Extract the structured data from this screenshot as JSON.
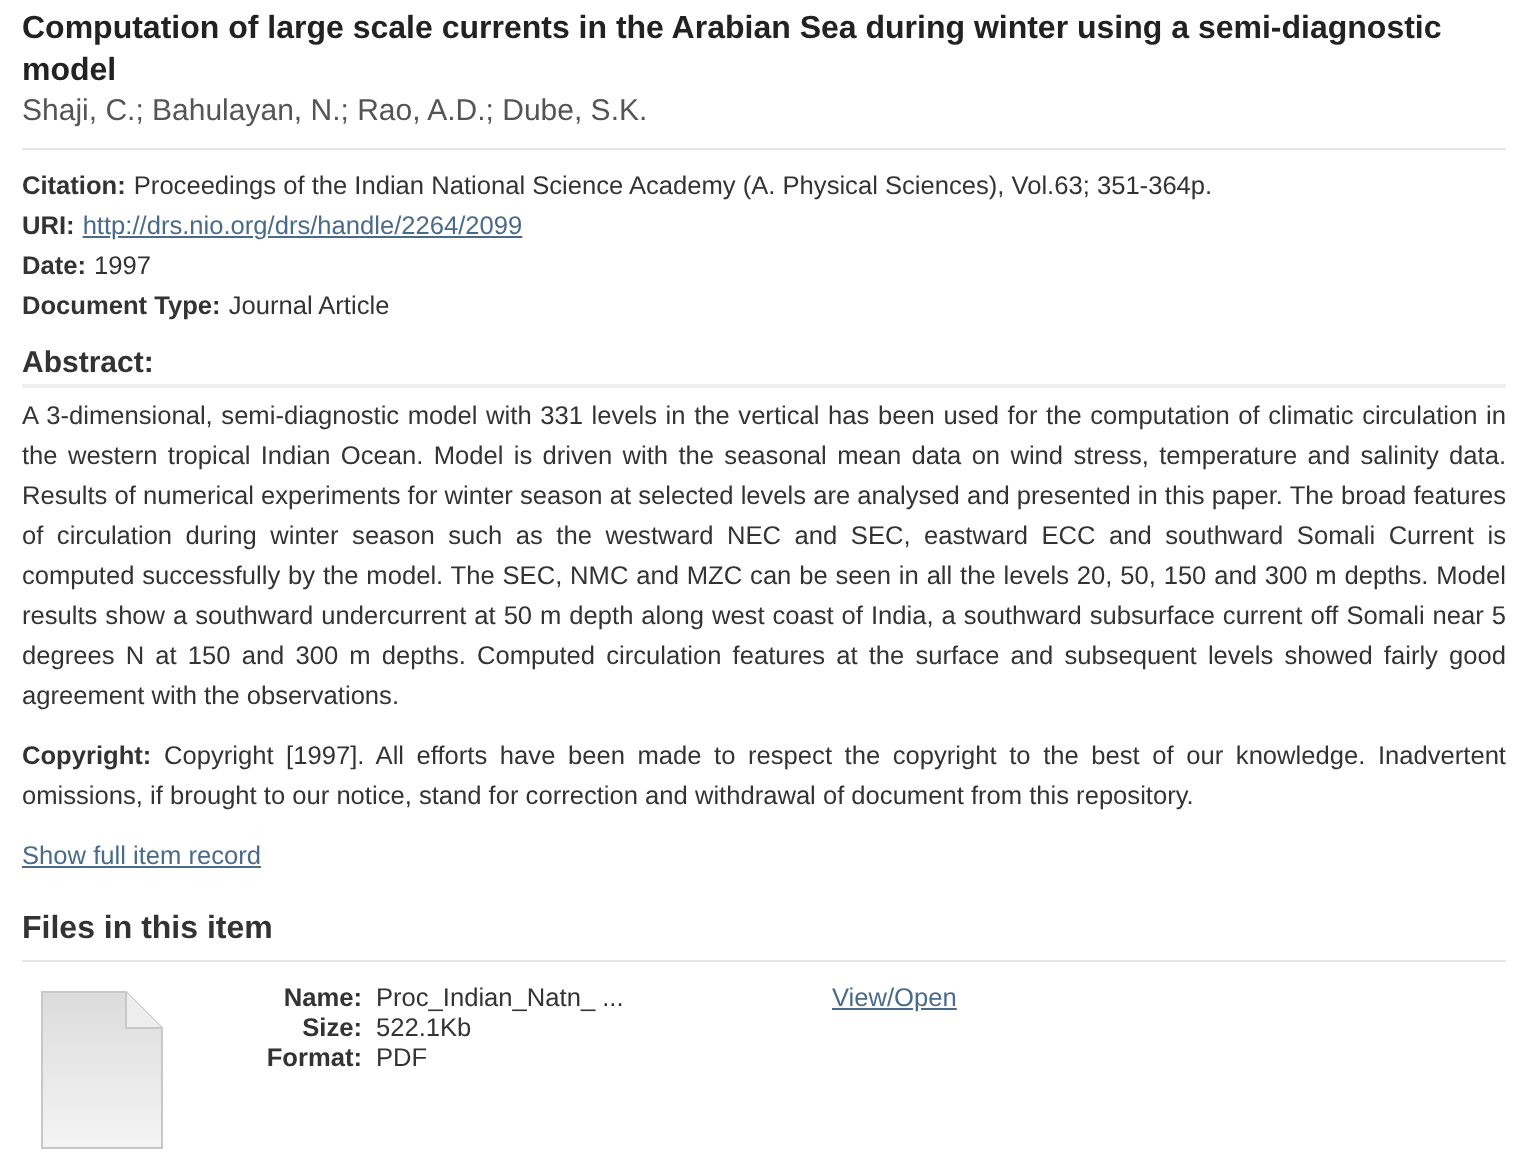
{
  "title": "Computation of large scale currents in the Arabian Sea during winter using a semi-diagnostic model",
  "authors": "Shaji, C.; Bahulayan, N.; Rao, A.D.; Dube, S.K.",
  "fields": [
    {
      "label": "Citation:",
      "value": "Proceedings of the Indian National Science Academy (A. Physical Sciences), Vol.63; 351-364p.",
      "kind": "text"
    },
    {
      "label": "URI:",
      "value": "http://drs.nio.org/drs/handle/2264/2099",
      "kind": "link"
    },
    {
      "label": "Date:",
      "value": "1997",
      "kind": "text"
    },
    {
      "label": "Document Type:",
      "value": "Journal Article",
      "kind": "text"
    }
  ],
  "abstract": {
    "heading": "Abstract:",
    "text": "A 3-dimensional, semi-diagnostic model with 331 levels in the vertical has been used for the computation of climatic circulation in the western tropical Indian Ocean. Model is driven with the seasonal mean data on wind stress, temperature and salinity data. Results of numerical experiments for winter season at selected levels are analysed and presented in this paper. The broad features of circulation during winter season such as the westward NEC and SEC, eastward ECC and southward Somali Current is computed successfully by the model. The SEC, NMC and MZC can be seen in all the levels 20, 50, 150 and 300 m depths. Model results show a southward undercurrent at 50 m depth along west coast of India, a southward subsurface current off Somali near 5 degrees N at 150 and 300 m depths. Computed circulation features at the surface and subsequent levels showed fairly good agreement with the observations."
  },
  "copyright": "**Copyright:** Copyright [1997]. All efforts have been made to respect the copyright to the best of our knowledge. Inadvertent omissions, if brought to our notice, stand for correction and withdrawal of document from this repository.",
  "full_record_link": "Show full item record",
  "files": {
    "heading": "Files in this item",
    "items": [
      {
        "rows": [
          {
            "label": "Name:",
            "value": "Proc_Indian_Natn_ ..."
          },
          {
            "label": "Size:",
            "value": "522.1Kb"
          },
          {
            "label": "Format:",
            "value": "PDF"
          }
        ],
        "link": "View/Open"
      }
    ]
  }
}
